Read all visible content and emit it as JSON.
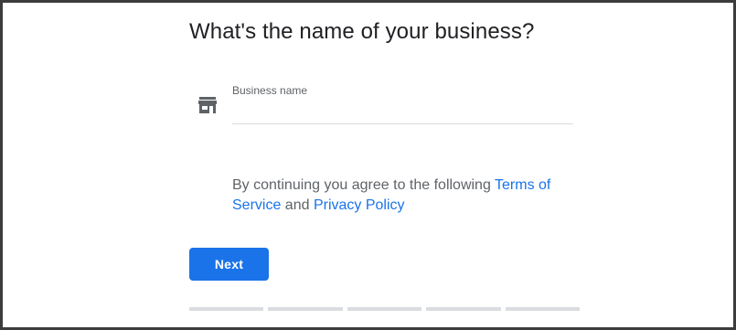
{
  "page": {
    "title": "What's the name of your business?"
  },
  "business_field": {
    "label": "Business name",
    "value": "",
    "icon": "storefront-icon"
  },
  "terms": {
    "prefix": "By continuing you agree to the following ",
    "terms_link": "Terms of Service",
    "conjunction": " and ",
    "privacy_link": "Privacy Policy"
  },
  "actions": {
    "next_label": "Next"
  },
  "progress": {
    "steps_total": 5,
    "steps_completed": 0
  },
  "colors": {
    "accent": "#1a73e8",
    "title_text": "#202124",
    "body_text": "#5f6368",
    "divider": "#dadce0"
  }
}
